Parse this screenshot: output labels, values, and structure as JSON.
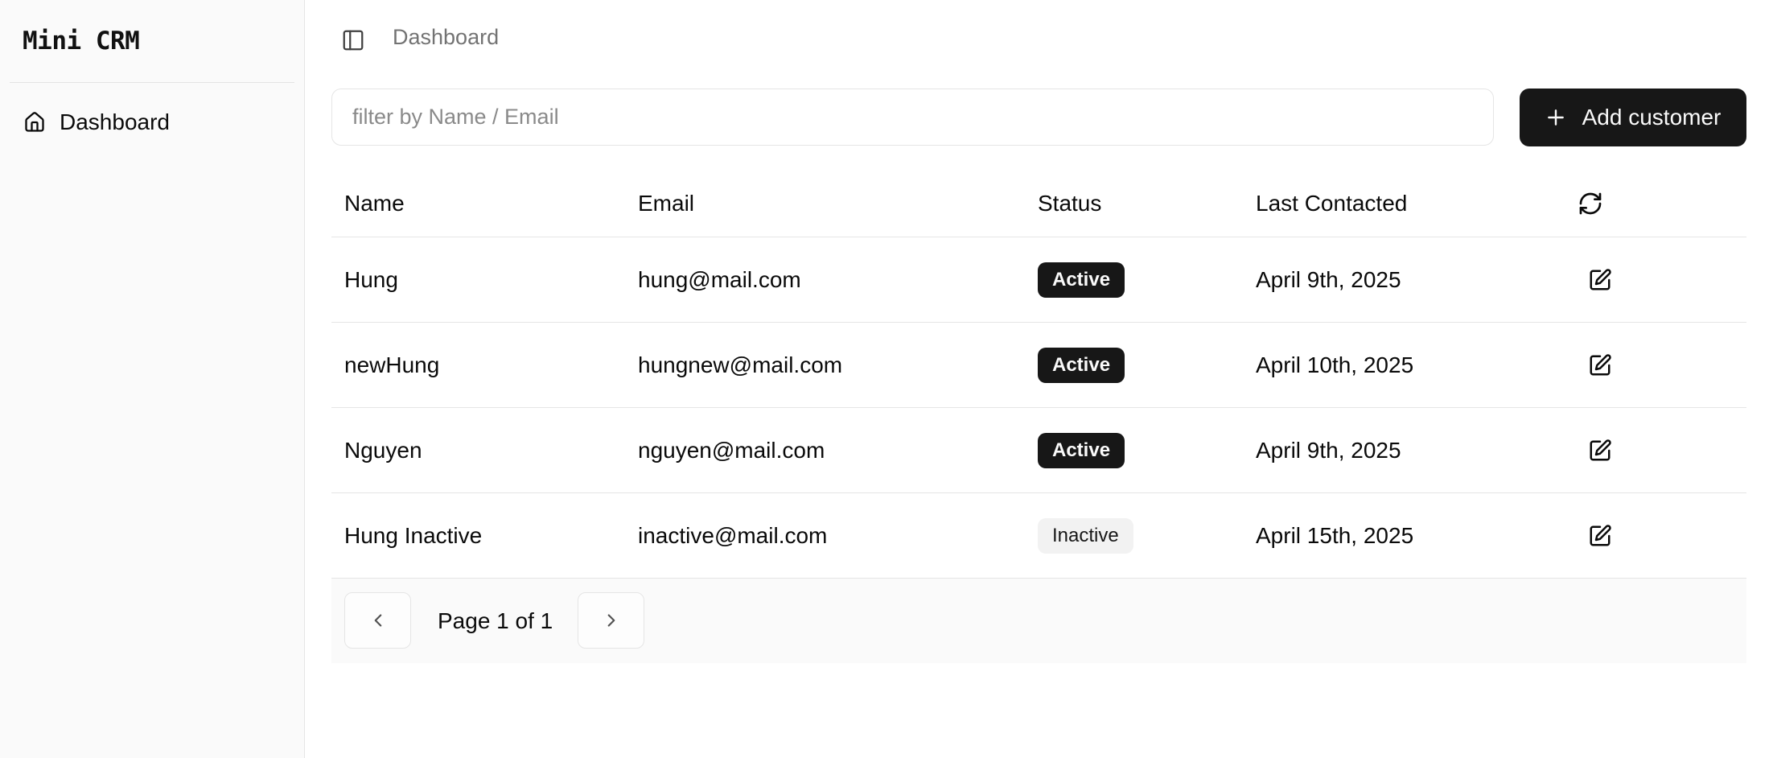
{
  "app": {
    "title": "Mini CRM"
  },
  "sidebar": {
    "items": [
      {
        "label": "Dashboard",
        "icon": "home-icon"
      }
    ]
  },
  "header": {
    "breadcrumb": "Dashboard"
  },
  "search": {
    "placeholder": "filter by Name / Email",
    "value": ""
  },
  "toolbar": {
    "add_label": "Add customer"
  },
  "table": {
    "columns": [
      "Name",
      "Email",
      "Status",
      "Last Contacted"
    ],
    "rows": [
      {
        "name": "Hung",
        "email": "hung@mail.com",
        "status": "Active",
        "last_contacted": "April 9th, 2025"
      },
      {
        "name": "newHung",
        "email": "hungnew@mail.com",
        "status": "Active",
        "last_contacted": "April 10th, 2025"
      },
      {
        "name": "Nguyen",
        "email": "nguyen@mail.com",
        "status": "Active",
        "last_contacted": "April 9th, 2025"
      },
      {
        "name": "Hung Inactive",
        "email": "inactive@mail.com",
        "status": "Inactive",
        "last_contacted": "April 15th, 2025"
      }
    ]
  },
  "pagination": {
    "label": "Page 1 of 1",
    "current": 1,
    "total": 1
  },
  "colors": {
    "primary": "#171717",
    "sidebar_bg": "#fafafa",
    "border": "#e5e5e5",
    "muted_text": "#737373"
  }
}
